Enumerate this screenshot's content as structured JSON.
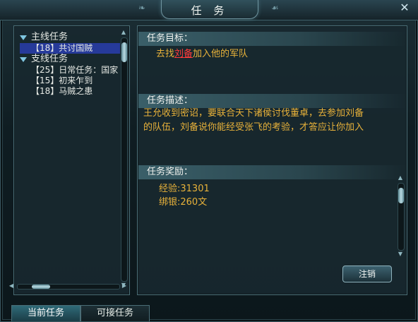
{
  "window": {
    "title": "任 务",
    "close_glyph": "✕"
  },
  "left": {
    "categories": [
      {
        "label": "主线任务",
        "quests": [
          {
            "label": "【18】共讨国贼",
            "selected": true
          }
        ]
      },
      {
        "label": "支线任务",
        "quests": [
          {
            "label": "【25】日常任务：国家",
            "selected": false
          },
          {
            "label": "【15】初来乍到",
            "selected": false
          },
          {
            "label": "【18】马贼之患",
            "selected": false
          }
        ]
      }
    ]
  },
  "detail": {
    "goal_header": "任务目标：",
    "goal_pre": "去找",
    "goal_npc": "刘备",
    "goal_post": "加入他的军队",
    "desc_header": "任务描述：",
    "desc_line1": "王允收到密诏，要联合天下诸侯讨伐董卓，去参加刘备",
    "desc_line2": "的队伍，刘备说你能经受张飞的考验，才答应让你加入",
    "reward_header": "任务奖励：",
    "reward_exp": "经验:31301",
    "reward_silver": "绑银:260文",
    "cancel_label": "注销"
  },
  "tabs": {
    "current": "当前任务",
    "available": "可接任务"
  },
  "colors": {
    "accent": "#e8b23a",
    "npc": "#ff3b3b",
    "selection": "#263a9a"
  }
}
